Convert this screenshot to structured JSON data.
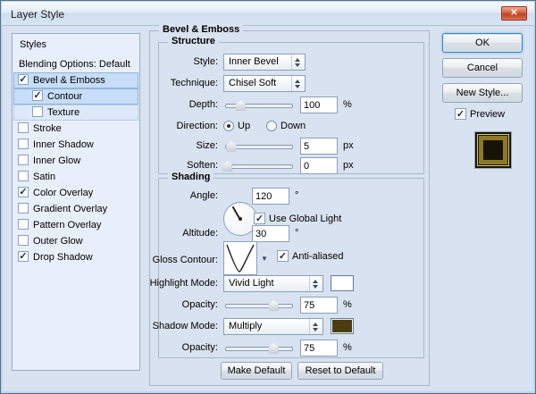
{
  "icons": {
    "check": "✓",
    "close": "✕",
    "dropdown_arrow": "▼"
  },
  "window": {
    "title": "Layer Style"
  },
  "sidebar": {
    "header": "Styles",
    "items": [
      {
        "label": "Blending Options: Default",
        "has_checkbox": false,
        "checked": false,
        "indent": false,
        "selected": 0
      },
      {
        "label": "Bevel & Emboss",
        "has_checkbox": true,
        "checked": true,
        "indent": false,
        "selected": 2
      },
      {
        "label": "Contour",
        "has_checkbox": true,
        "checked": true,
        "indent": true,
        "selected": 2
      },
      {
        "label": "Texture",
        "has_checkbox": true,
        "checked": false,
        "indent": true,
        "selected": 1
      },
      {
        "label": "Stroke",
        "has_checkbox": true,
        "checked": false,
        "indent": false,
        "selected": 0
      },
      {
        "label": "Inner Shadow",
        "has_checkbox": true,
        "checked": false,
        "indent": false,
        "selected": 0
      },
      {
        "label": "Inner Glow",
        "has_checkbox": true,
        "checked": false,
        "indent": false,
        "selected": 0
      },
      {
        "label": "Satin",
        "has_checkbox": true,
        "checked": false,
        "indent": false,
        "selected": 0
      },
      {
        "label": "Color Overlay",
        "has_checkbox": true,
        "checked": true,
        "indent": false,
        "selected": 0
      },
      {
        "label": "Gradient Overlay",
        "has_checkbox": true,
        "checked": false,
        "indent": false,
        "selected": 0
      },
      {
        "label": "Pattern Overlay",
        "has_checkbox": true,
        "checked": false,
        "indent": false,
        "selected": 0
      },
      {
        "label": "Outer Glow",
        "has_checkbox": true,
        "checked": false,
        "indent": false,
        "selected": 0
      },
      {
        "label": "Drop Shadow",
        "has_checkbox": true,
        "checked": true,
        "indent": false,
        "selected": 0
      }
    ]
  },
  "panel": {
    "title": "Bevel & Emboss",
    "structure": {
      "title": "Structure",
      "style": {
        "label": "Style:",
        "value": "Inner Bevel"
      },
      "technique": {
        "label": "Technique:",
        "value": "Chisel Soft"
      },
      "depth": {
        "label": "Depth:",
        "value": "100",
        "unit": "%",
        "thumb_left": "22%"
      },
      "direction": {
        "label": "Direction:",
        "up": "Up",
        "down": "Down",
        "selected": "Up"
      },
      "size": {
        "label": "Size:",
        "value": "5",
        "unit": "px",
        "thumb_left": "8%"
      },
      "soften": {
        "label": "Soften:",
        "value": "0",
        "unit": "px",
        "thumb_left": "2%"
      }
    },
    "shading": {
      "title": "Shading",
      "angle": {
        "label": "Angle:",
        "value": "120",
        "unit": "°"
      },
      "use_global_light": {
        "label": "Use Global Light",
        "checked": true
      },
      "altitude": {
        "label": "Altitude:",
        "value": "30",
        "unit": "°"
      },
      "gloss_contour": {
        "label": "Gloss Contour:"
      },
      "anti_aliased": {
        "label": "Anti-aliased",
        "checked": true
      },
      "highlight_mode": {
        "label": "Highlight Mode:",
        "value": "Vivid Light",
        "swatch": "#ffffff"
      },
      "opacity_highlight": {
        "label": "Opacity:",
        "value": "75",
        "unit": "%",
        "thumb_left": "72%"
      },
      "shadow_mode": {
        "label": "Shadow Mode:",
        "value": "Multiply",
        "swatch": "#4a3e10"
      },
      "opacity_shadow": {
        "label": "Opacity:",
        "value": "75",
        "unit": "%",
        "thumb_left": "72%"
      }
    },
    "footer": {
      "make_default": "Make Default",
      "reset_to_default": "Reset to Default"
    }
  },
  "actions": {
    "ok": "OK",
    "cancel": "Cancel",
    "new_style": "New Style...",
    "preview": "Preview",
    "preview_checked": true
  }
}
